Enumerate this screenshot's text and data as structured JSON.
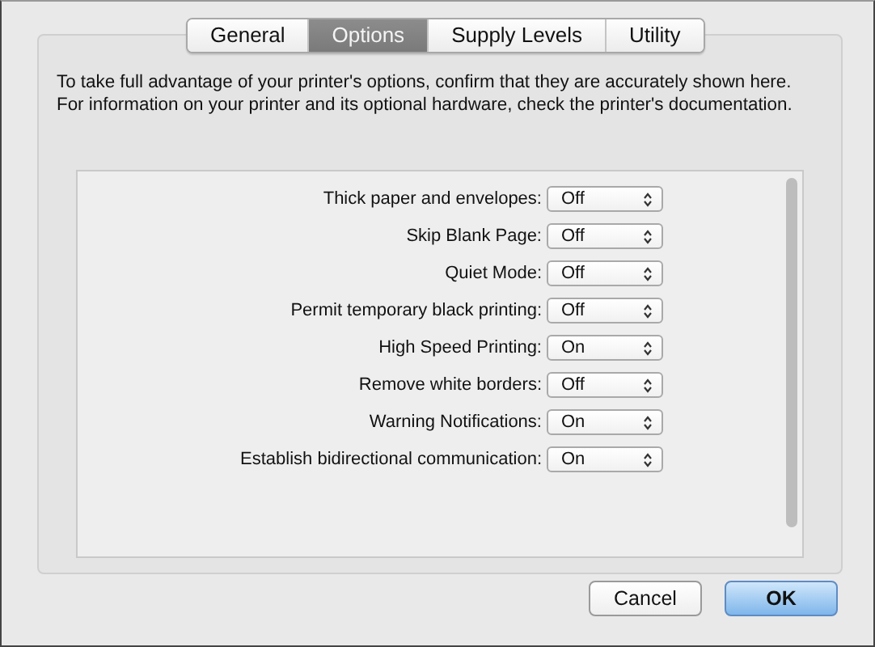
{
  "tabs": [
    {
      "label": "General",
      "selected": false
    },
    {
      "label": "Options",
      "selected": true
    },
    {
      "label": "Supply Levels",
      "selected": false
    },
    {
      "label": "Utility",
      "selected": false
    }
  ],
  "description": "To take full advantage of your printer's options, confirm that they are accurately shown here. For information on your printer and its optional hardware, check the printer's documentation.",
  "options": [
    {
      "label": "Thick paper and envelopes:",
      "value": "Off"
    },
    {
      "label": "Skip Blank Page:",
      "value": "Off"
    },
    {
      "label": "Quiet Mode:",
      "value": "Off"
    },
    {
      "label": "Permit temporary black printing:",
      "value": "Off"
    },
    {
      "label": "High Speed Printing:",
      "value": "On"
    },
    {
      "label": "Remove white borders:",
      "value": "Off"
    },
    {
      "label": "Warning Notifications:",
      "value": "On"
    },
    {
      "label": "Establish bidirectional communication:",
      "value": "On"
    }
  ],
  "buttons": [
    {
      "label": "Cancel",
      "kind": "normal"
    },
    {
      "label": "OK",
      "kind": "default"
    }
  ]
}
